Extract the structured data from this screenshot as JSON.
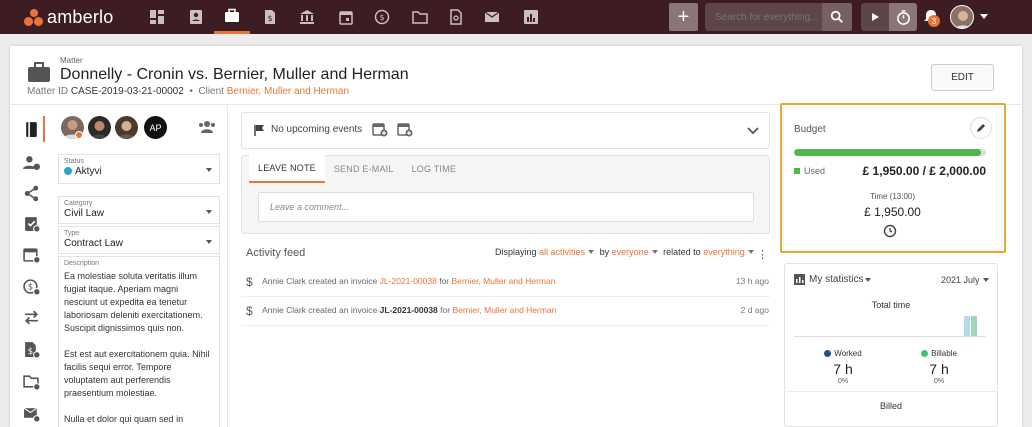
{
  "app": {
    "name": "amberlo"
  },
  "search": {
    "placeholder": "Search for everything..."
  },
  "notifications": {
    "count": "3"
  },
  "matter": {
    "label": "Matter",
    "title": "Donnelly - Cronin vs. Bernier, Muller and Herman",
    "id_label": "Matter ID",
    "id": "CASE-2019-03-21-00002",
    "client_label": "Client",
    "client": "Bernier, Muller and Herman",
    "edit_label": "EDIT"
  },
  "people": {
    "initials": "AP"
  },
  "fields": {
    "status": {
      "label": "Status",
      "value": "Aktyvi"
    },
    "category": {
      "label": "Category",
      "value": "Civil Law"
    },
    "type": {
      "label": "Type",
      "value": "Contract Law"
    },
    "description": {
      "label": "Description",
      "p1": "Ea molestiae soluta veritatis illum fugiat itaque. Aperiam magni nesciunt ut expedita ea tenetur laboriosam deleniti exercitationem. Suscipit dignissimos quis non.",
      "p2": "Est est aut exercitationem quia. Nihil facilis sequi error. Tempore voluptatem aut perferendis praesentium molestiae.",
      "p3": "Nulla et dolor qui quam sed in consequatur dicta. Sed sit et rerum"
    }
  },
  "events": {
    "text": "No upcoming events"
  },
  "note_tabs": [
    "LEAVE NOTE",
    "SEND E-MAIL",
    "LOG TIME"
  ],
  "comment": {
    "placeholder": "Leave a comment..."
  },
  "feed": {
    "title": "Activity feed",
    "displaying": "Displaying",
    "all_activities": "all activities",
    "by": "by",
    "everyone": "everyone",
    "related_to": "related to",
    "everything": "everything",
    "rows": [
      {
        "actor": "Annie Clark created an invoice ",
        "invoice": "JL-2021-00038",
        "for": " for ",
        "client": "Bernier, Muller and Herman",
        "time": "13 h ago"
      },
      {
        "actor": "Annie Clark created an invoice ",
        "invoice": "JL-2021-00038",
        "for": " for ",
        "client": "Bernier, Muller and Herman",
        "time": "2 d ago"
      }
    ]
  },
  "budget": {
    "title": "Budget",
    "used_label": "Used",
    "amount": "£ 1,950.00 / £ 2,000.00",
    "used_fraction": 0.975,
    "time_label": "Time (13:00)",
    "time_value": "£ 1,950.00",
    "bar_color": "#4cb84c"
  },
  "stats": {
    "title": "My statistics",
    "month": "2021 July",
    "total_label": "Total time",
    "worked_label": "Worked",
    "worked_value": "7 h",
    "worked_pct": "0%",
    "billable_label": "Billable",
    "billable_value": "7 h",
    "billable_pct": "0%",
    "billed_label": "Billed"
  },
  "colors": {
    "accent": "#e8743b",
    "topbar": "#3d1d22",
    "highlight": "#e6a83a"
  }
}
